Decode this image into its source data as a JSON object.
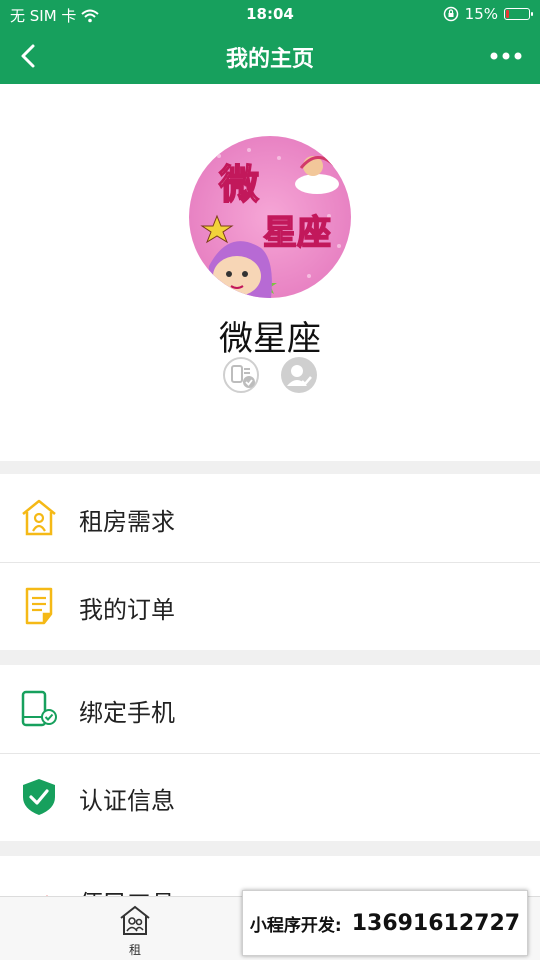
{
  "status": {
    "carrier": "无 SIM 卡",
    "time": "18:04",
    "battery_percent": "15%",
    "battery_level": 0.15,
    "icons": [
      "wifi-icon",
      "orientation-lock-icon",
      "battery-icon"
    ]
  },
  "nav": {
    "title": "我的主页",
    "back_icon": "chevron-left-icon",
    "more_icon": "more-dots-icon",
    "bg_color": "#17a05d"
  },
  "profile": {
    "name": "微星座",
    "avatar_text": [
      "微",
      "星座"
    ],
    "badges": [
      "phone-verified-icon",
      "identity-verified-icon"
    ]
  },
  "menu": [
    {
      "id": "rent-demand",
      "label": "租房需求",
      "icon": "house-icon",
      "color": "#f5b916"
    },
    {
      "id": "my-orders",
      "label": "我的订单",
      "icon": "document-icon",
      "color": "#f5b916"
    },
    {
      "id": "bind-phone",
      "label": "绑定手机",
      "icon": "phone-check-icon",
      "color": "#17a05d"
    },
    {
      "id": "verify-info",
      "label": "认证信息",
      "icon": "shield-check-icon",
      "color": "#17a05d"
    },
    {
      "id": "convenience-tools",
      "label": "便民工具",
      "icon": "tools-grid-icon",
      "color": "#e53935"
    }
  ],
  "tabbar": {
    "rent_label": "租",
    "rent_icon": "home-people-icon"
  },
  "promo": {
    "label": "小程序开发:",
    "phone": "13691612727"
  }
}
